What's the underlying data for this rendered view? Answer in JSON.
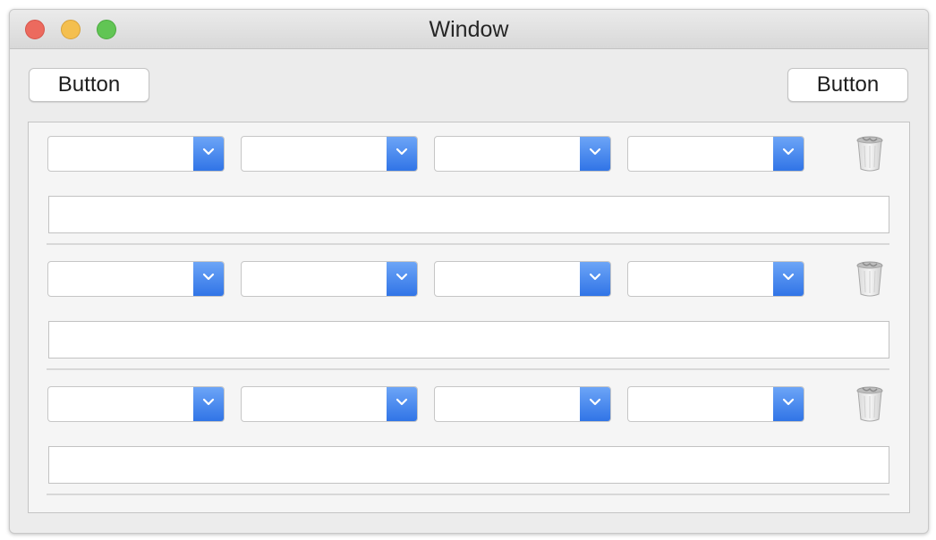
{
  "window": {
    "title": "Window",
    "traffic_lights": {
      "close_color": "#ec6a5e",
      "minimize_color": "#f4bf4f",
      "zoom_color": "#61c554"
    }
  },
  "toolbar": {
    "left_button_label": "Button",
    "right_button_label": "Button"
  },
  "accent_color": "#3b7ee9",
  "rows": [
    {
      "popups": [
        {
          "selected": ""
        },
        {
          "selected": ""
        },
        {
          "selected": ""
        },
        {
          "selected": ""
        }
      ],
      "text_field": {
        "value": "",
        "placeholder": ""
      },
      "icon": "trash-icon"
    },
    {
      "popups": [
        {
          "selected": ""
        },
        {
          "selected": ""
        },
        {
          "selected": ""
        },
        {
          "selected": ""
        }
      ],
      "text_field": {
        "value": "",
        "placeholder": ""
      },
      "icon": "trash-icon"
    },
    {
      "popups": [
        {
          "selected": ""
        },
        {
          "selected": ""
        },
        {
          "selected": ""
        },
        {
          "selected": ""
        }
      ],
      "text_field": {
        "value": "",
        "placeholder": ""
      },
      "icon": "trash-icon"
    }
  ]
}
